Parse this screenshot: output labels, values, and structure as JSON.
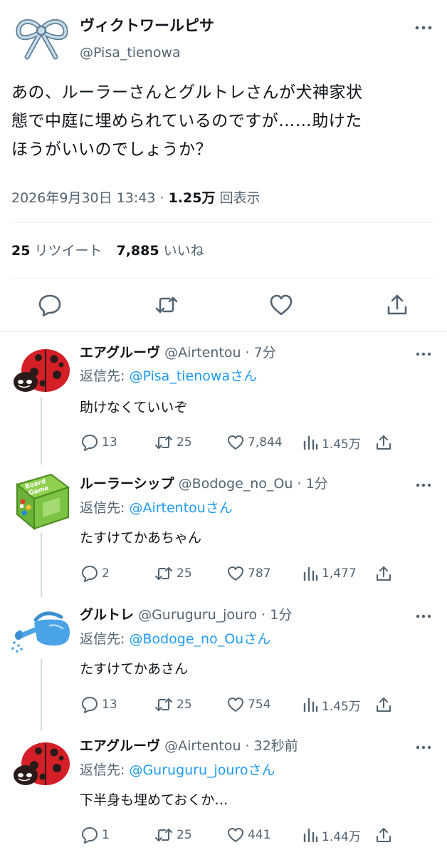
{
  "tweet": {
    "author_name": "ヴィクトワールピサ",
    "author_handle": "@Pisa_tienowa",
    "text_line1": "あの、ルーラーさんとグルトレさんが犬神家状",
    "text_line2": "態で中庭に埋められているのですが……助けた",
    "text_line3": "ほうがいいのでしょうか？",
    "datetime": "2026年9月30日 13:43",
    "separator": "·",
    "views": "1.25万",
    "views_label": "回表示",
    "retweets": "25",
    "retweets_label": "リツイート",
    "likes": "7,885",
    "likes_label": "いいね"
  },
  "replies": [
    {
      "name": "エアグルーヴ",
      "handle": "@Airtentou",
      "time": "· 7分",
      "reply_to_label": "返信先:",
      "reply_to_user": "@Pisa_tienowaさん",
      "text": "助けなくていいぞ",
      "comments": "13",
      "retweets": "25",
      "likes": "7,844",
      "views": "1.45万",
      "avatar": "ladybug-icon"
    },
    {
      "name": "ルーラーシップ",
      "handle": "@Bodoge_no_Ou",
      "time": "· 1分",
      "reply_to_label": "返信先:",
      "reply_to_user": "@Airtentouさん",
      "text": "たすけてかあちゃん",
      "comments": "2",
      "retweets": "25",
      "likes": "787",
      "views": "1,477",
      "avatar": "board-game-box-icon",
      "box_text_1": "Board",
      "box_text_2": "Game"
    },
    {
      "name": "グルトレ",
      "handle": "@Guruguru_jouro",
      "time": "· 1分",
      "reply_to_label": "返信先:",
      "reply_to_user": "@Bodoge_no_Ouさん",
      "text": "たすけてかあさん",
      "comments": "13",
      "retweets": "25",
      "likes": "754",
      "views": "1.45万",
      "avatar": "watering-can-icon"
    },
    {
      "name": "エアグルーヴ",
      "handle": "@Airtentou",
      "time": "· 32秒前",
      "reply_to_label": "返信先:",
      "reply_to_user": "@Guruguru_jouroさん",
      "text": "下半身も埋めておくか…",
      "comments": "1",
      "retweets": "25",
      "likes": "441",
      "views": "1.44万",
      "avatar": "ladybug-icon"
    }
  ],
  "colors": {
    "link": "#1d9bf0",
    "secondary": "#536471",
    "text": "#0f1419",
    "divider": "#eff3f4"
  }
}
